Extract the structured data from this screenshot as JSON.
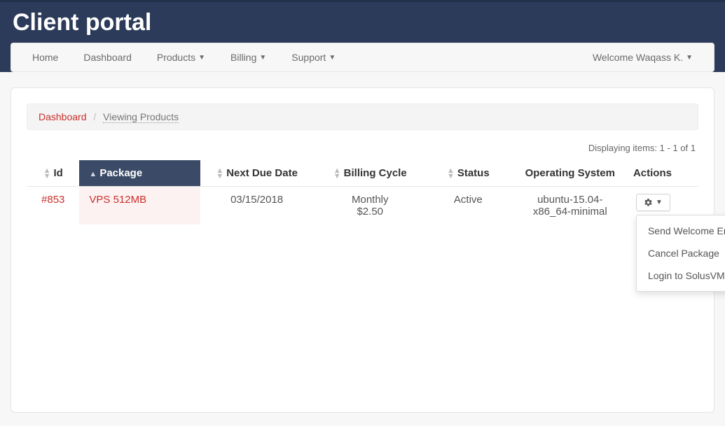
{
  "header": {
    "title": "Client portal"
  },
  "nav": {
    "left": [
      {
        "label": "Home",
        "dropdown": false
      },
      {
        "label": "Dashboard",
        "dropdown": false
      },
      {
        "label": "Products",
        "dropdown": true
      },
      {
        "label": "Billing",
        "dropdown": true
      },
      {
        "label": "Support",
        "dropdown": true
      }
    ],
    "right": {
      "label": "Welcome Waqass K.",
      "dropdown": true
    }
  },
  "breadcrumb": {
    "link": "Dashboard",
    "current": "Viewing Products"
  },
  "list_info": "Displaying items: 1 - 1 of 1",
  "table": {
    "headers": {
      "id": "Id",
      "package": "Package",
      "next_due": "Next Due Date",
      "billing_cycle": "Billing Cycle",
      "status": "Status",
      "os": "Operating System",
      "actions": "Actions"
    },
    "rows": [
      {
        "id": "#853",
        "package": "VPS 512MB",
        "next_due": "03/15/2018",
        "billing_cycle_line1": "Monthly",
        "billing_cycle_line2": "$2.50",
        "status": "Active",
        "os_line1": "ubuntu-15.04-",
        "os_line2": "x86_64-minimal"
      }
    ]
  },
  "actions_menu": {
    "items": [
      "Send Welcome Email",
      "Cancel Package",
      "Login to SolusVM"
    ]
  }
}
